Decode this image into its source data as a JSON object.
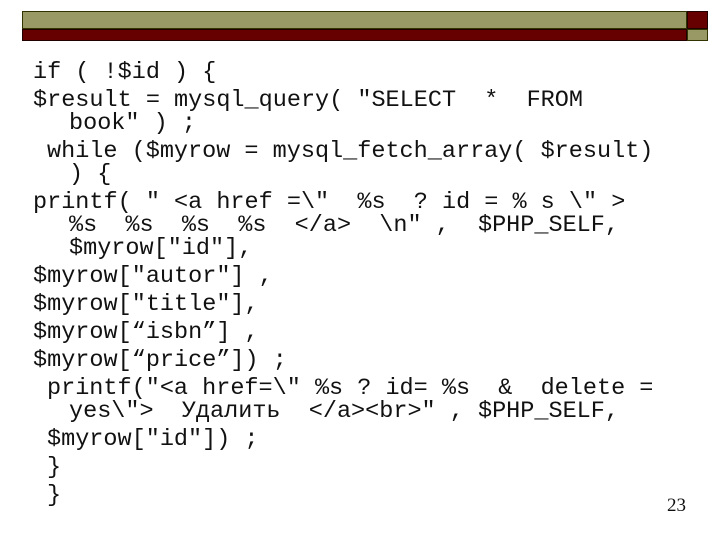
{
  "slide": {
    "page_number": "23",
    "colors": {
      "header_olive": "#999966",
      "header_dark_red": "#660000"
    },
    "code_lines": [
      {
        "text": "if ( !$id ) {"
      },
      {
        "text": "$result = mysql_query( \"SELECT  *  FROM",
        "cont": "book\" ) ;"
      },
      {
        "text": "while ($myrow = mysql_fetch_array( $result)",
        "cont": ") {"
      },
      {
        "text": "printf( \" <a href =\\\"  %s  ? id = % s \\\" >",
        "cont": "%s  %s  %s  %s  </a>  \\n\" ,  $PHP_SELF,",
        "cont2": "$myrow[\"id\"],"
      },
      {
        "text": "$myrow[\"autor\"] ,"
      },
      {
        "text": "$myrow[\"title\"],"
      },
      {
        "text": "$myrow[“isbn”] ,"
      },
      {
        "text": "$myrow[“price”]) ;"
      },
      {
        "text": "printf(\"<a href=\\\" %s ? id= %s  &  delete =",
        "cont": "yes\\\">  Удалить  </a><br>\" , $PHP_SELF,"
      },
      {
        "text": "$myrow[\"id\"]) ;"
      },
      {
        "text": "}"
      },
      {
        "text": "}"
      }
    ]
  }
}
